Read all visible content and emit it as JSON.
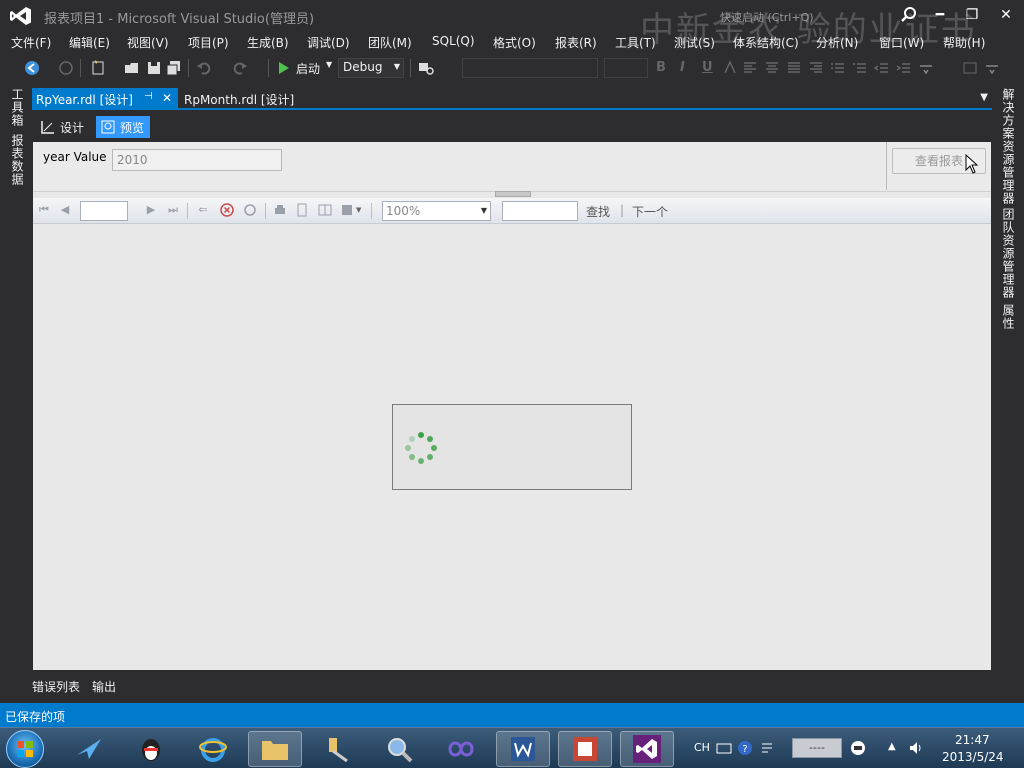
{
  "window": {
    "title": "报表项目1 - Microsoft Visual Studio(管理员)",
    "watermark": "中新金农  验的业证书",
    "quick_launch_placeholder": "快速启动 (Ctrl+Q)",
    "minimize": "━",
    "restore": "❐",
    "close": "✕"
  },
  "menu": [
    "文件(F)",
    "编辑(E)",
    "视图(V)",
    "项目(P)",
    "生成(B)",
    "调试(D)",
    "团队(M)",
    "SQL(Q)",
    "格式(O)",
    "报表(R)",
    "工具(T)",
    "测试(S)",
    "体系结构(C)",
    "分析(N)",
    "窗口(W)",
    "帮助(H)"
  ],
  "toolbar": {
    "start_label": "启动",
    "config_value": "Debug",
    "format_bold": "B",
    "format_italic": "I",
    "format_underline": "U"
  },
  "left_rail": [
    "工具箱",
    "报表数据"
  ],
  "right_rail": [
    "解决方案资源管理器",
    "团队资源管理器",
    "属性"
  ],
  "doc_tabs": [
    {
      "label": "RpYear.rdl [设计]",
      "active": true,
      "pin": "⊣",
      "close": "✕"
    },
    {
      "label": "RpMonth.rdl [设计]",
      "active": false
    }
  ],
  "doc_tabs_dropdown": "▼",
  "sub_tabs": [
    {
      "label": "设计",
      "active": false
    },
    {
      "label": "预览",
      "active": true
    }
  ],
  "parameters": {
    "label": "year Value",
    "value": "2010",
    "view_report_button": "查看报表"
  },
  "viewer_toolbar": {
    "zoom_value": "100%",
    "find_label": "查找",
    "separator": "|",
    "next_label": "下一个"
  },
  "bottom_tabs": [
    "错误列表",
    "输出"
  ],
  "status": {
    "text": "已保存的项"
  },
  "taskbar": {
    "lang_indicator": "CH",
    "ime_text": "----",
    "clock_time": "21:47",
    "clock_date": "2013/5/24"
  },
  "colors": {
    "accent": "#007acc",
    "chrome_bg": "#2d2d30",
    "preview_active": "#3399ff",
    "report_bg": "#e8e8e8"
  }
}
